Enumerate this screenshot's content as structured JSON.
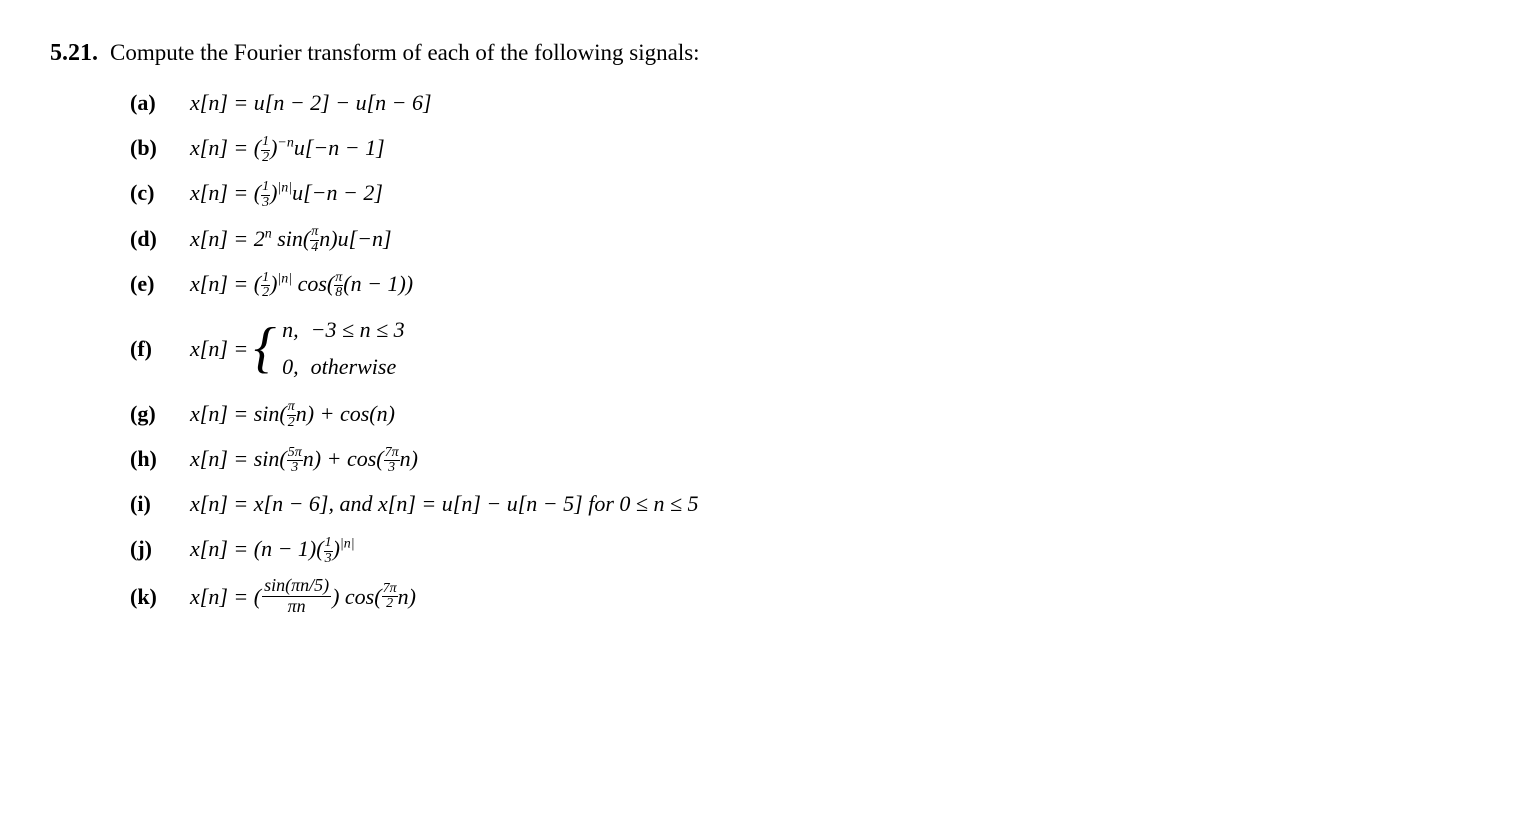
{
  "problem": {
    "number": "5.21.",
    "instruction": "Compute the Fourier transform of each of the following signals:",
    "parts": [
      {
        "label": "(a)",
        "text_key": "a"
      },
      {
        "label": "(b)",
        "text_key": "b"
      },
      {
        "label": "(c)",
        "text_key": "c"
      },
      {
        "label": "(d)",
        "text_key": "d"
      },
      {
        "label": "(e)",
        "text_key": "e"
      },
      {
        "label": "(f)",
        "text_key": "f"
      },
      {
        "label": "(g)",
        "text_key": "g"
      },
      {
        "label": "(h)",
        "text_key": "h"
      },
      {
        "label": "(i)",
        "text_key": "i"
      },
      {
        "label": "(j)",
        "text_key": "j"
      },
      {
        "label": "(k)",
        "text_key": "k"
      }
    ]
  }
}
